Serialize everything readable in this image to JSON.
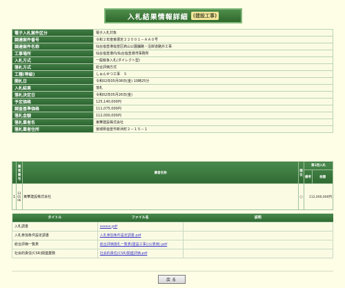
{
  "header": {
    "title": "入札結果情報詳細",
    "tag": "(建設工事)"
  },
  "info_rows": [
    {
      "label": "電子入札案件区分",
      "value": "電子入札対象"
    },
    {
      "label": "調達案件番号",
      "value": "令和２年度東選定２２００１－ＡＡ０号"
    },
    {
      "label": "調達案件名称",
      "value": "仙台塩釜港塩釜区肩山公園舗路・沿岸道路外工事"
    },
    {
      "label": "工事場所",
      "value": "仙台塩釜港内/仙台塩釜港湾事務所"
    },
    {
      "label": "入札方式",
      "value": "一般競争入札(ダイレクト型)"
    },
    {
      "label": "落札方式",
      "value": "総合評価方式"
    },
    {
      "label": "工種(等級)",
      "value": "しゅんせつ工事　Ｓ"
    },
    {
      "label": "開札日",
      "value": "令和02年05月08日(金) 10時25分"
    },
    {
      "label": "入札結果",
      "value": "落札"
    },
    {
      "label": "落札決定日",
      "value": "令和02年05月26日(金)"
    },
    {
      "label": "予定価格",
      "value": "125,140,000円"
    },
    {
      "label": "調査基準価格",
      "value": "111,075,000円"
    },
    {
      "label": "落札金額",
      "value": "112,000,000円"
    },
    {
      "label": "落札業者名",
      "value": "東華建設株式会社"
    },
    {
      "label": "落札業者住所",
      "value": "宮城県塩釜市新浜町２－１５－１"
    }
  ],
  "bid_table": {
    "col_no": "業者番号",
    "col_name": "業者名称",
    "col_rank": "順位",
    "col_round": "第1回入札",
    "col_amount": "金額",
    "col_note": "備考",
    "rows": [
      {
        "idx": "1",
        "code": "13 01 06",
        "name": "東華建設株式会社",
        "mark": "○",
        "amount": "112,000,000円"
      }
    ]
  },
  "files": {
    "headers": [
      "タイトル",
      "ファイル名",
      "説明"
    ],
    "rows": [
      {
        "title": "入札調書",
        "file": "ssssss.pdf",
        "desc": ""
      },
      {
        "title": "入札参加条件設定調書",
        "file": "入札参加条件設定調書.pdf",
        "desc": ""
      },
      {
        "title": "総合評価一覧表",
        "file": "総合評価落札一覧表(建設工事)(公表用).pdf",
        "desc": ""
      },
      {
        "title": "社会的責任(CSR)関連業務",
        "file": "社会的責任(CSR)関連評価.pdf",
        "desc": ""
      }
    ]
  },
  "back_label": "戻る"
}
